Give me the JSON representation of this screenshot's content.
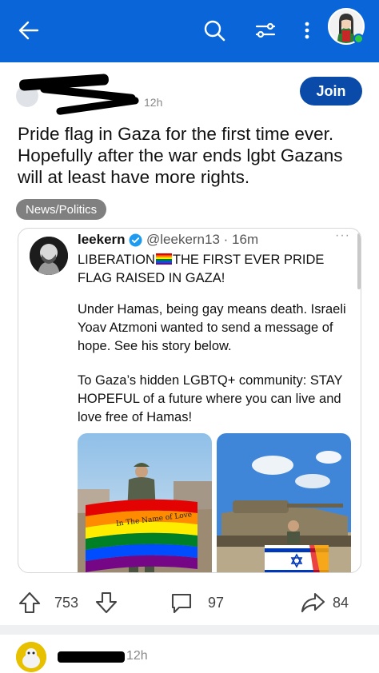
{
  "appbar": {
    "background": "#0a66d8",
    "icons": [
      "back-arrow-icon",
      "search-icon",
      "filter-icon",
      "more-vertical-icon",
      "user-avatar"
    ]
  },
  "post": {
    "time": "12h",
    "join_label": "Join",
    "title": "Pride flag in Gaza for the first time ever. Hopefully after the war ends lgbt Gazans will at least have more rights.",
    "flair": "News/Politics"
  },
  "tweet": {
    "name": "leekern",
    "handle": "@leekern13 · 16m",
    "more": "···",
    "line1_a": "LIBERATION",
    "line1_b": "THE FIRST EVER PRIDE",
    "line2": "FLAG RAISED IN GAZA!",
    "para2": "Under Hamas, being gay means death. Israeli Yoav Atzmoni wanted to send a message of hope. See his story below.",
    "para3": "To Gaza’s hidden LGBTQ+ community: STAY HOPEFUL of a future where you can live and love free of Hamas!",
    "flag_text": "In The Name of Love"
  },
  "actions": {
    "upvotes": "753",
    "comments": "97",
    "shares": "84"
  },
  "comment": {
    "time": "12h"
  }
}
